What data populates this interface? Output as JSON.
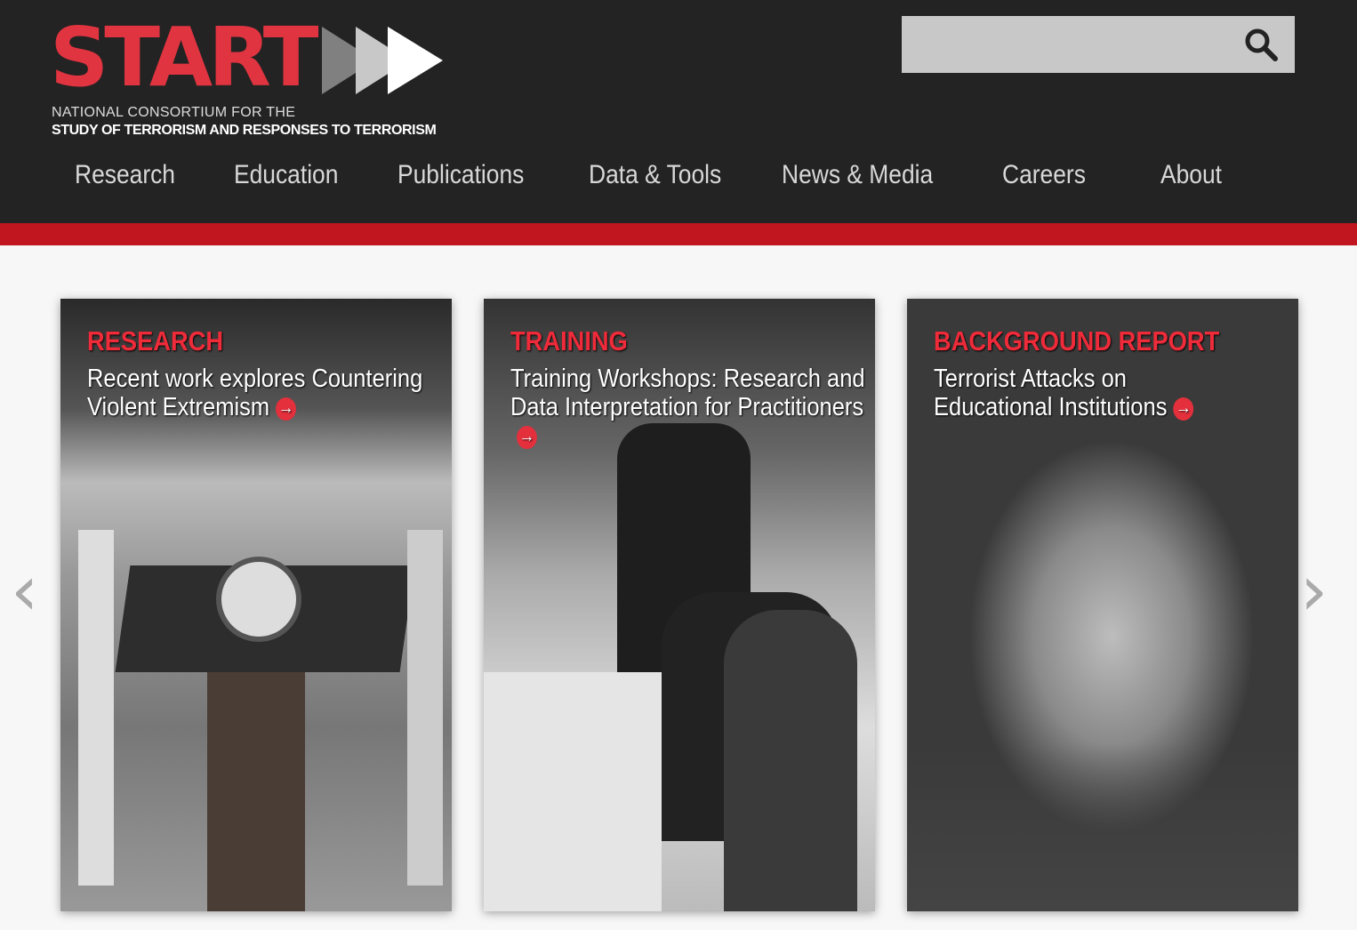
{
  "logo": {
    "word": "START",
    "line1": "NATIONAL CONSORTIUM FOR THE",
    "line2": "STUDY OF TERRORISM AND RESPONSES TO TERRORISM"
  },
  "search": {
    "placeholder": "",
    "value": "",
    "icon": "search-icon"
  },
  "nav": [
    "Research",
    "Education",
    "Publications",
    "Data & Tools",
    "News & Media",
    "Careers",
    "About"
  ],
  "cards": [
    {
      "category": "RESEARCH",
      "title": "Recent work explores Countering Violent Extremism"
    },
    {
      "category": "TRAINING",
      "title": "Training Workshops: Research and Data Interpretation for Practitioners"
    },
    {
      "category": "BACKGROUND REPORT",
      "title": "Terrorist Attacks on Educational Institutions"
    }
  ],
  "carousel": {
    "prev": "‹",
    "next": "›"
  },
  "colors": {
    "header": "#232323",
    "accent": "#c1161f",
    "category": "#ef2b3a"
  }
}
